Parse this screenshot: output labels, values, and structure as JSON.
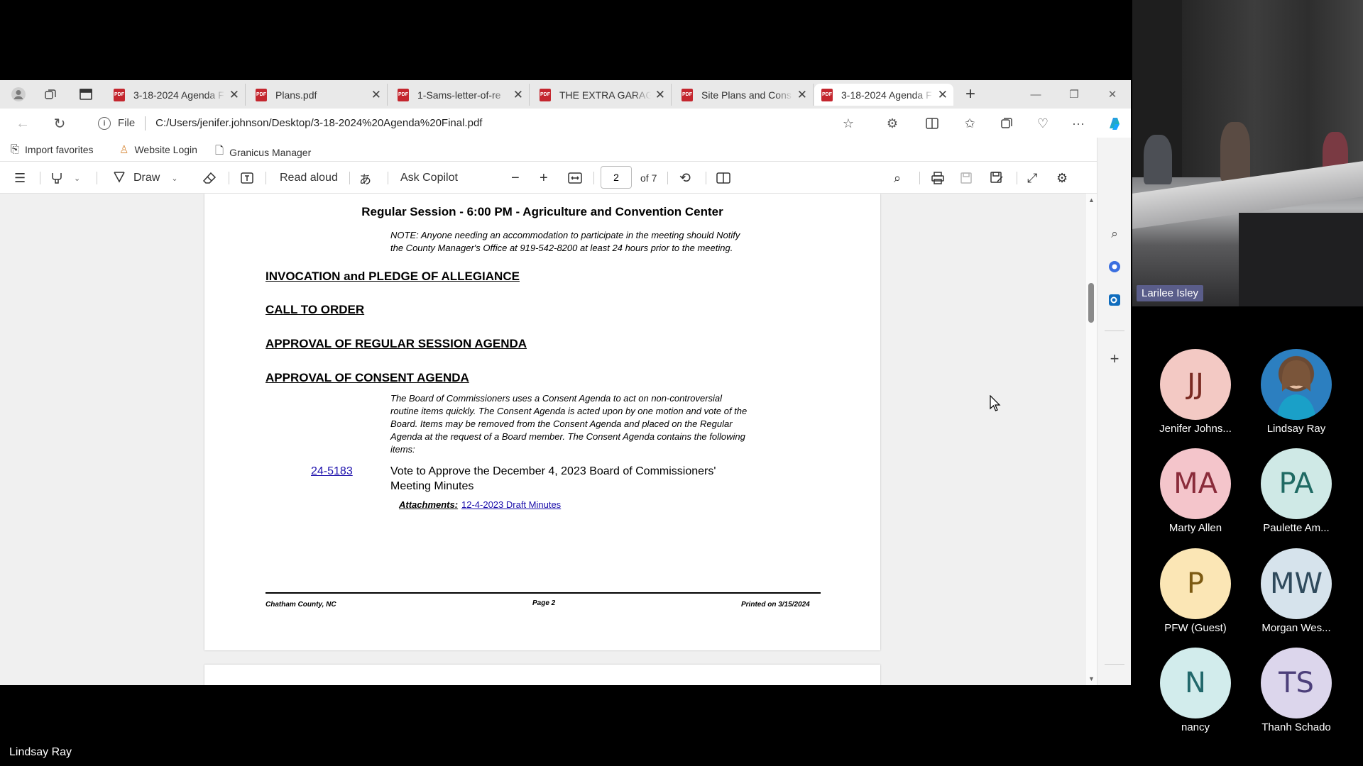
{
  "browser": {
    "tabs": [
      {
        "title": "3-18-2024 Agenda F",
        "active": false
      },
      {
        "title": "Plans.pdf",
        "active": false
      },
      {
        "title": "1-Sams-letter-of-re",
        "active": false
      },
      {
        "title": "THE EXTRA GARAGE",
        "active": false
      },
      {
        "title": "Site Plans and Cons",
        "active": false
      },
      {
        "title": "3-18-2024 Agenda F",
        "active": true
      }
    ],
    "address": {
      "file_label": "File",
      "url": "C:/Users/jenifer.johnson/Desktop/3-18-2024%20Agenda%20Final.pdf"
    },
    "favorites": [
      {
        "label": "Import favorites",
        "icon": "import-icon"
      },
      {
        "label": "Website Login",
        "icon": "person-icon"
      },
      {
        "label": "Granicus Manager",
        "icon": "page-icon"
      }
    ],
    "pdf_toolbar": {
      "draw": "Draw",
      "read_aloud": "Read aloud",
      "ask_copilot": "Ask Copilot",
      "page_value": "2",
      "page_total": "of 7"
    }
  },
  "document": {
    "session_title": "Regular Session - 6:00 PM - Agriculture and Convention Center",
    "note_line1": "NOTE: Anyone needing an accommodation to participate in the meeting should Notify",
    "note_line2": "the County Manager's Office at 919-542-8200 at least 24 hours prior to the meeting.",
    "sections": [
      "INVOCATION and PLEDGE OF ALLEGIANCE",
      "CALL TO ORDER",
      "APPROVAL OF REGULAR SESSION AGENDA",
      "APPROVAL OF CONSENT AGENDA"
    ],
    "consent_lines": [
      "The Board of Commissioners uses a Consent Agenda to act on non-controversial",
      "routine items quickly. The Consent Agenda is acted upon by one motion and vote of the",
      "Board. Items may be removed from the Consent Agenda and placed on the Regular",
      "Agenda at the request of a Board member. The Consent Agenda contains the following",
      "items:"
    ],
    "item_number": "24-5183",
    "item_line1": "Vote to Approve the December 4, 2023 Board of Commissioners'",
    "item_line2": "Meeting Minutes",
    "attachments_label": "Attachments:",
    "attachment_link": "12-4-2023 Draft Minutes",
    "footer_left": "Chatham County, NC",
    "footer_center": "Page 2",
    "footer_right": "Printed on 3/15/2024"
  },
  "video": {
    "speaker_tag": "Larilee Isley"
  },
  "participants": [
    {
      "initials": "JJ",
      "name": "Jenifer Johns...",
      "bg": "#f3c9c4",
      "fg": "#7a2a22"
    },
    {
      "initials": "",
      "name": "Lindsay Ray",
      "bg": "#3f7fb3",
      "fg": "#ffffff",
      "photo": true
    },
    {
      "initials": "MA",
      "name": "Marty Allen",
      "bg": "#f4c5cb",
      "fg": "#8a2b3a"
    },
    {
      "initials": "PA",
      "name": "Paulette Am...",
      "bg": "#cfe9e6",
      "fg": "#1f6a63"
    },
    {
      "initials": "P",
      "name": "PFW (Guest)",
      "bg": "#fbe6b5",
      "fg": "#7c5a12"
    },
    {
      "initials": "MW",
      "name": "Morgan Wes...",
      "bg": "#d6e3ec",
      "fg": "#2f4a5c"
    },
    {
      "initials": "N",
      "name": "nancy",
      "bg": "#d2ecec",
      "fg": "#22686b"
    },
    {
      "initials": "TS",
      "name": "Thanh Schado",
      "bg": "#dcd6ec",
      "fg": "#4c3f7a"
    }
  ],
  "active_speaker_label": "Lindsay Ray"
}
